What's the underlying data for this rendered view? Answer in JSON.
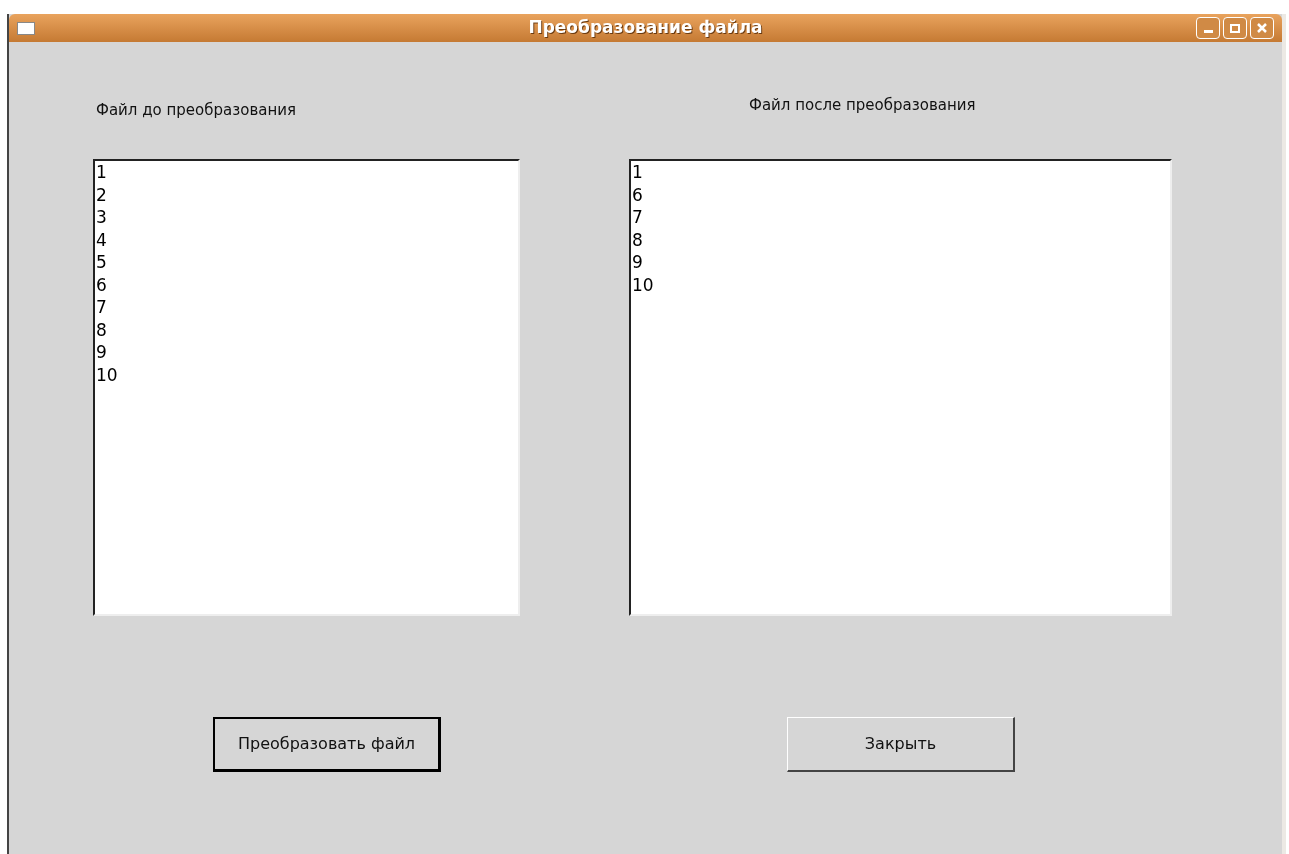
{
  "window": {
    "title": "Преобразование файла"
  },
  "lists": [
    {
      "label": "Файл до преобразования",
      "items": [
        "1",
        "2",
        "3",
        "4",
        "5",
        "6",
        "7",
        "8",
        "9",
        "10"
      ]
    },
    {
      "label": "Файл после преобразования",
      "items": [
        "1",
        "6",
        "7",
        "8",
        "9",
        "10"
      ]
    }
  ],
  "buttons": [
    {
      "label": "Преобразовать файл",
      "default": true
    },
    {
      "label": "Закрыть",
      "default": false
    }
  ]
}
